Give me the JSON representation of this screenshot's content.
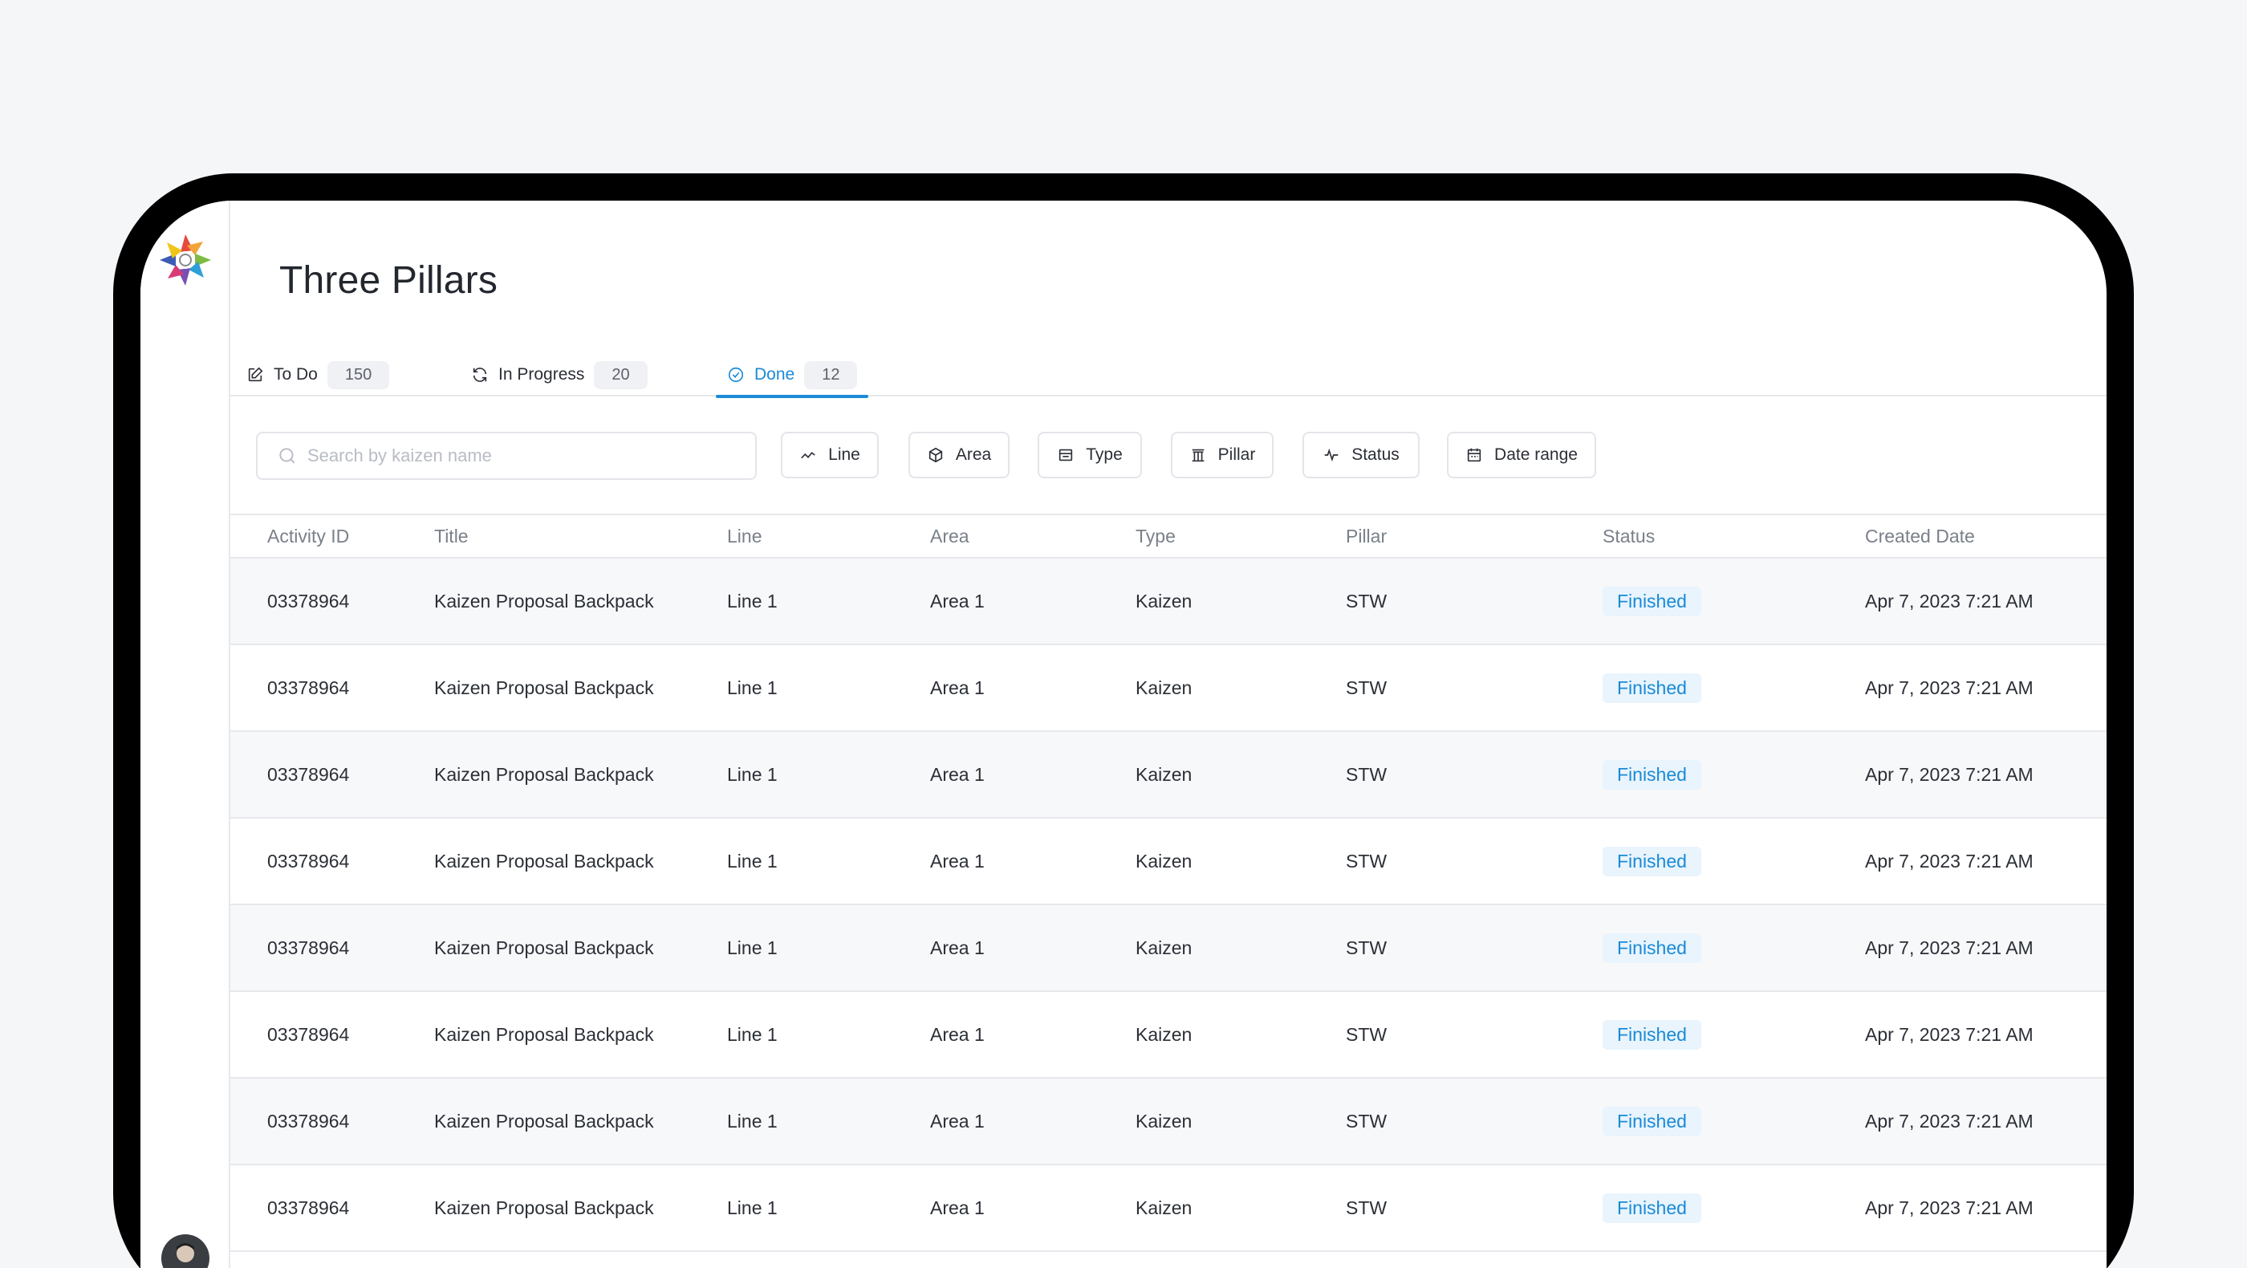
{
  "page_title": "Three Pillars",
  "tabs": [
    {
      "label": "To Do",
      "count": "150",
      "icon": "edit-icon",
      "active": false
    },
    {
      "label": "In Progress",
      "count": "20",
      "icon": "refresh-icon",
      "active": false
    },
    {
      "label": "Done",
      "count": "12",
      "icon": "check-circle-icon",
      "active": true
    }
  ],
  "search": {
    "placeholder": "Search by kaizen name",
    "value": ""
  },
  "filters": [
    {
      "label": "Line",
      "icon": "trend-line-icon"
    },
    {
      "label": "Area",
      "icon": "cube-icon"
    },
    {
      "label": "Type",
      "icon": "card-icon"
    },
    {
      "label": "Pillar",
      "icon": "pillar-icon"
    },
    {
      "label": "Status",
      "icon": "activity-icon"
    },
    {
      "label": "Date range",
      "icon": "calendar-icon"
    }
  ],
  "table": {
    "columns": [
      "Activity ID",
      "Title",
      "Line",
      "Area",
      "Type",
      "Pillar",
      "Status",
      "Created Date"
    ],
    "rows": [
      [
        "03378964",
        "Kaizen Proposal Backpack",
        "Line 1",
        "Area 1",
        "Kaizen",
        "STW",
        "Finished",
        "Apr 7, 2023 7:21 AM"
      ],
      [
        "03378964",
        "Kaizen Proposal Backpack",
        "Line 1",
        "Area 1",
        "Kaizen",
        "STW",
        "Finished",
        "Apr 7, 2023 7:21 AM"
      ],
      [
        "03378964",
        "Kaizen Proposal Backpack",
        "Line 1",
        "Area 1",
        "Kaizen",
        "STW",
        "Finished",
        "Apr 7, 2023 7:21 AM"
      ],
      [
        "03378964",
        "Kaizen Proposal Backpack",
        "Line 1",
        "Area 1",
        "Kaizen",
        "STW",
        "Finished",
        "Apr 7, 2023 7:21 AM"
      ],
      [
        "03378964",
        "Kaizen Proposal Backpack",
        "Line 1",
        "Area 1",
        "Kaizen",
        "STW",
        "Finished",
        "Apr 7, 2023 7:21 AM"
      ],
      [
        "03378964",
        "Kaizen Proposal Backpack",
        "Line 1",
        "Area 1",
        "Kaizen",
        "STW",
        "Finished",
        "Apr 7, 2023 7:21 AM"
      ],
      [
        "03378964",
        "Kaizen Proposal Backpack",
        "Line 1",
        "Area 1",
        "Kaizen",
        "STW",
        "Finished",
        "Apr 7, 2023 7:21 AM"
      ],
      [
        "03378964",
        "Kaizen Proposal Backpack",
        "Line 1",
        "Area 1",
        "Kaizen",
        "STW",
        "Finished",
        "Apr 7, 2023 7:21 AM"
      ]
    ]
  },
  "colors": {
    "accent": "#1a8ad6",
    "badge_bg": "#e9f4fd",
    "device_frame": "#000000"
  }
}
